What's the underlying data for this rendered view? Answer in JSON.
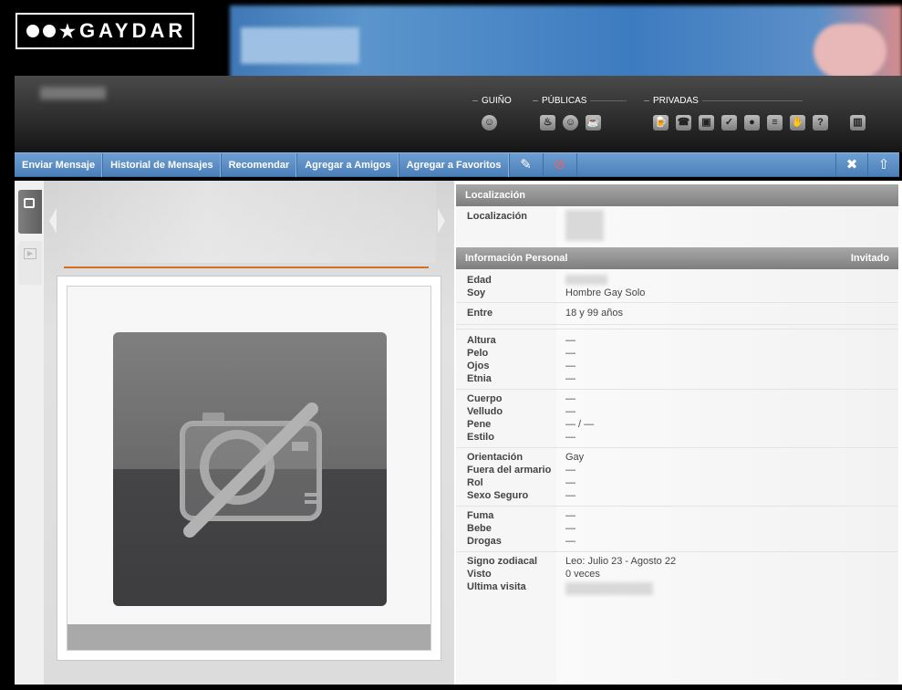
{
  "brand": {
    "logo_text": "GAYDAR"
  },
  "header": {
    "groups": [
      {
        "label": "GUIÑO"
      },
      {
        "label": "PÚBLICAS"
      },
      {
        "label": "PRIVADAS"
      }
    ],
    "icons": {
      "guino": [
        "wink-icon"
      ],
      "publicas": [
        "fire-icon",
        "smile-icon",
        "coffee-icon"
      ],
      "privadas": [
        "beer-icon",
        "phone-book-icon",
        "camera-icon",
        "check-icon",
        "lightbulb-icon",
        "note-icon",
        "hand-icon",
        "question-icon",
        "trash-icon"
      ]
    }
  },
  "toolbar": {
    "buttons": [
      "Enviar Mensaje",
      "Historial de Mensajes",
      "Recomendar",
      "Agregar a Amigos",
      "Agregar a Favoritos"
    ],
    "icon_buttons": [
      "pencil-icon",
      "paw-blocked-icon"
    ],
    "right_buttons": [
      "close-icon",
      "upload-icon"
    ]
  },
  "location": {
    "header": "Localización",
    "label": "Localización"
  },
  "personal": {
    "header": "Información Personal",
    "badge": "Invitado",
    "edad_label": "Edad",
    "soy_label": "Soy",
    "soy_value": "Hombre Gay Solo",
    "entre_label": "Entre",
    "entre_value": "18 y 99 años",
    "altura_label": "Altura",
    "altura_value": "—",
    "pelo_label": "Pelo",
    "pelo_value": "—",
    "ojos_label": "Ojos",
    "ojos_value": "—",
    "etnia_label": "Etnia",
    "etnia_value": "—",
    "cuerpo_label": "Cuerpo",
    "cuerpo_value": "—",
    "velludo_label": "Velludo",
    "velludo_value": "—",
    "pene_label": "Pene",
    "pene_value": "— / —",
    "estilo_label": "Estilo",
    "estilo_value": "—",
    "orientacion_label": "Orientación",
    "orientacion_value": "Gay",
    "armario_label": "Fuera del armario",
    "armario_value": "—",
    "rol_label": "Rol",
    "rol_value": "—",
    "sexo_label": "Sexo Seguro",
    "sexo_value": "—",
    "fuma_label": "Fuma",
    "fuma_value": "—",
    "bebe_label": "Bebe",
    "bebe_value": "—",
    "drogas_label": "Drogas",
    "drogas_value": "—",
    "signo_label": "Signo zodiacal",
    "signo_value": "Leo: Julio 23 - Agosto 22",
    "visto_label": "Visto",
    "visto_value": "0 veces",
    "ultima_label": "Ultima visita"
  }
}
